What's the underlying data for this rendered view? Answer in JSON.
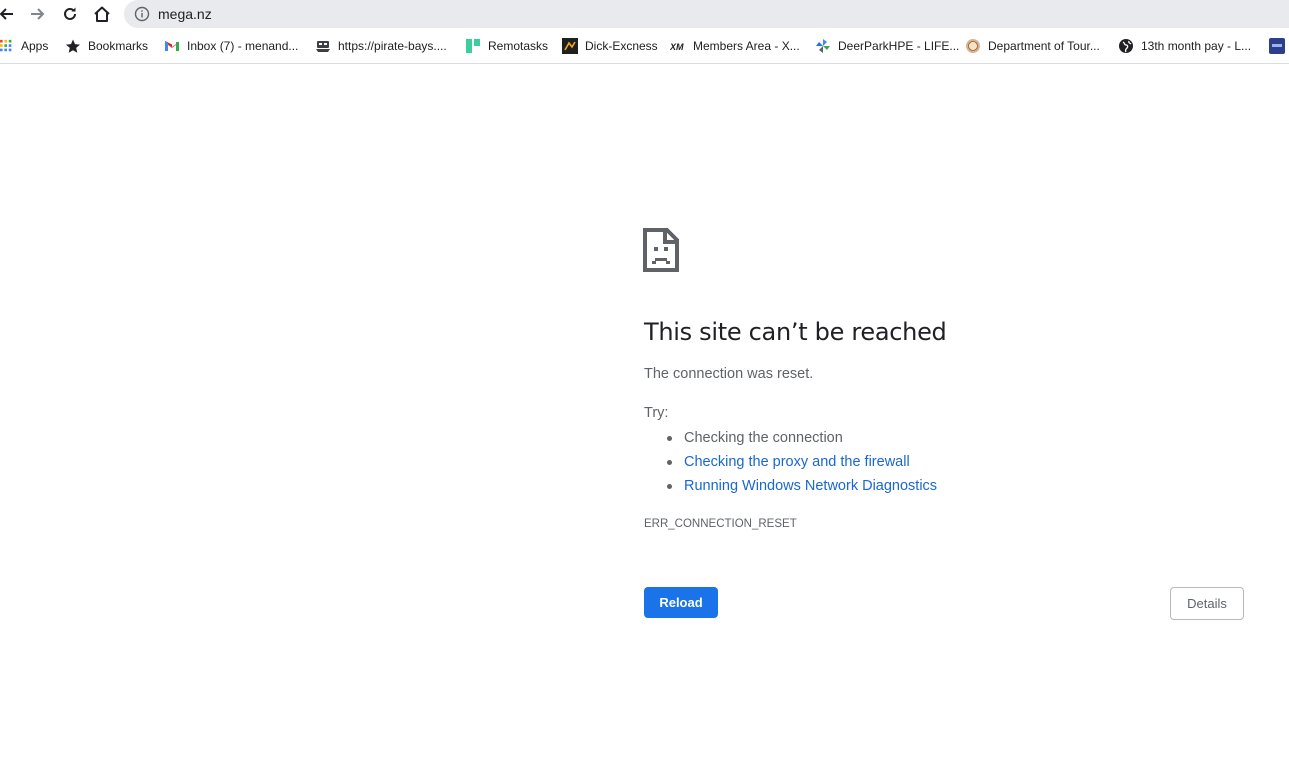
{
  "browser": {
    "url": "mega.nz",
    "nav_icons": [
      "back-arrow-icon",
      "forward-arrow-icon",
      "reload-icon",
      "home-icon",
      "info-icon"
    ]
  },
  "bookmarks": [
    {
      "label": "Apps",
      "icon": "apps-grid-icon"
    },
    {
      "label": "Bookmarks",
      "icon": "star-icon"
    },
    {
      "label": "Inbox (7) - menand...",
      "icon": "gmail-icon"
    },
    {
      "label": "https://pirate-bays....",
      "icon": "pirate-ship-icon"
    },
    {
      "label": "Remotasks",
      "icon": "remotasks-icon"
    },
    {
      "label": "Dick-Excness",
      "icon": "exness-icon"
    },
    {
      "label": "Members Area - X...",
      "icon": "xm-icon"
    },
    {
      "label": "DeerParkHPE - LIFE...",
      "icon": "pinwheel-icon"
    },
    {
      "label": "Department of Tour...",
      "icon": "seal-icon"
    },
    {
      "label": "13th month pay - L...",
      "icon": "globe-icon"
    }
  ],
  "error": {
    "icon": "sad-page-icon",
    "title": "This site can’t be reached",
    "description": "The connection was reset.",
    "try_label": "Try:",
    "suggestions": [
      {
        "text": "Checking the connection",
        "link": false
      },
      {
        "text": "Checking the proxy and the firewall",
        "link": true
      },
      {
        "text": "Running Windows Network Diagnostics",
        "link": true
      }
    ],
    "code": "ERR_CONNECTION_RESET"
  },
  "buttons": {
    "reload": "Reload",
    "details": "Details"
  },
  "colors": {
    "primary_blue": "#1a73e8",
    "link_blue": "#1967d2",
    "omnibox_gray": "#e8eaed",
    "text_dark": "#202124",
    "text_gray": "#5f6368"
  }
}
